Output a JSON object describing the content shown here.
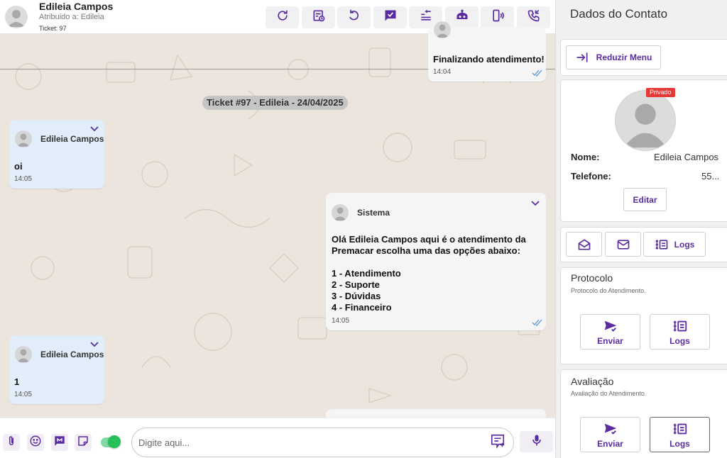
{
  "header": {
    "contact_name": "Edileia Campos",
    "assigned": "Atribuido a: Edileia",
    "ticket": "Ticket: 97",
    "actions": [
      "refresh-icon",
      "schedule-icon",
      "undo-icon",
      "resolve-icon",
      "transfer-icon",
      "bot-icon",
      "device-icon",
      "call-icon"
    ]
  },
  "chat": {
    "messages": [
      {
        "direction": "out",
        "sender": "",
        "text": "Finalizando atendimento!",
        "time": "14:04",
        "status": "read"
      },
      {
        "direction": "in",
        "sender": "Edileia Campos",
        "text": "oi",
        "time": "14:05"
      },
      {
        "direction": "out",
        "sender": "Sistema",
        "text": "Olá Edileia Campos aqui é o atendimento da\nPremacar escolha uma das opções abaixo:\n\n1 - Atendimento\n2 - Suporte\n3 - Dúvidas\n4 - Financeiro",
        "time": "14:05",
        "status": "read"
      },
      {
        "direction": "in",
        "sender": "Edileia Campos",
        "text": "1",
        "time": "14:05"
      }
    ],
    "date_divider": "Ticket #97 - Edileia - 24/04/2025"
  },
  "composer": {
    "placeholder": "Digite aqui...",
    "toggle_on": true,
    "buttons": [
      "attach-icon",
      "emoji-icon",
      "quick-reply-icon",
      "note-icon"
    ]
  },
  "panel": {
    "title": "Dados do Contato",
    "reduce_menu": "Reduzir Menu",
    "privado_badge": "Privado",
    "name_label": "Nome:",
    "name_value": "Edileia Campos",
    "phone_label": "Telefone:",
    "phone_value": "55...",
    "edit_button": "Editar",
    "logs_button": "Logs",
    "protocolo": {
      "title": "Protocolo",
      "subtitle": "Protocolo do Atendimento.",
      "send": "Enviar",
      "logs": "Logs"
    },
    "avaliacao": {
      "title": "Avaliação",
      "subtitle": "Avaliação do Atendimento.",
      "send": "Enviar",
      "logs": "Logs"
    }
  },
  "colors": {
    "accent": "#5a2ca0",
    "incoming_bubble": "#e1eefa",
    "outgoing_bubble": "#f5f5f5",
    "chat_background": "#ece5dd",
    "toggle_on": "#26c05a",
    "badge": "#e53935",
    "read_check": "#5b9bd5"
  }
}
